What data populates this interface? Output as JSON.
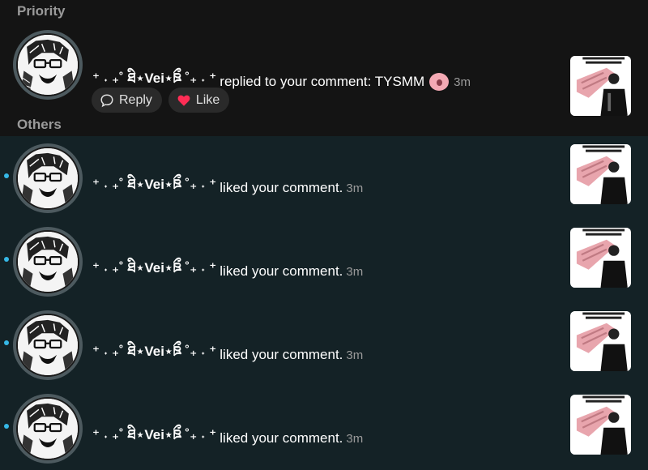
{
  "sections": {
    "priority": "Priority",
    "others": "Others"
  },
  "priority_items": [
    {
      "username": "⁺ ˖ ₊˚ ཐི⋆Vei⋆ཋྀ ˚₊ ˖ ⁺",
      "action": "replied to your comment: TYSMM",
      "emoji": "pig-face-emoji",
      "time": "3m",
      "reply_label": "Reply",
      "like_label": "Like"
    }
  ],
  "other_items": [
    {
      "username": "⁺ ˖ ₊˚ ཐི⋆Vei⋆ཋྀ ˚₊ ˖ ⁺",
      "action": "liked your comment.",
      "time": "3m",
      "unread": true
    },
    {
      "username": "⁺ ˖ ₊˚ ཐི⋆Vei⋆ཋྀ ˚₊ ˖ ⁺",
      "action": "liked your comment.",
      "time": "3m",
      "unread": true
    },
    {
      "username": "⁺ ˖ ₊˚ ཐི⋆Vei⋆ཋྀ ˚₊ ˖ ⁺",
      "action": "liked your comment.",
      "time": "3m",
      "unread": true
    },
    {
      "username": "⁺ ˖ ₊˚ ཐི⋆Vei⋆ཋྀ ˚₊ ˖ ⁺",
      "action": "liked your comment.",
      "time": "3m",
      "unread": true
    }
  ],
  "colors": {
    "unread_dot": "#36b8e6",
    "like_heart": "#ff2d55",
    "others_background": "#142226"
  }
}
